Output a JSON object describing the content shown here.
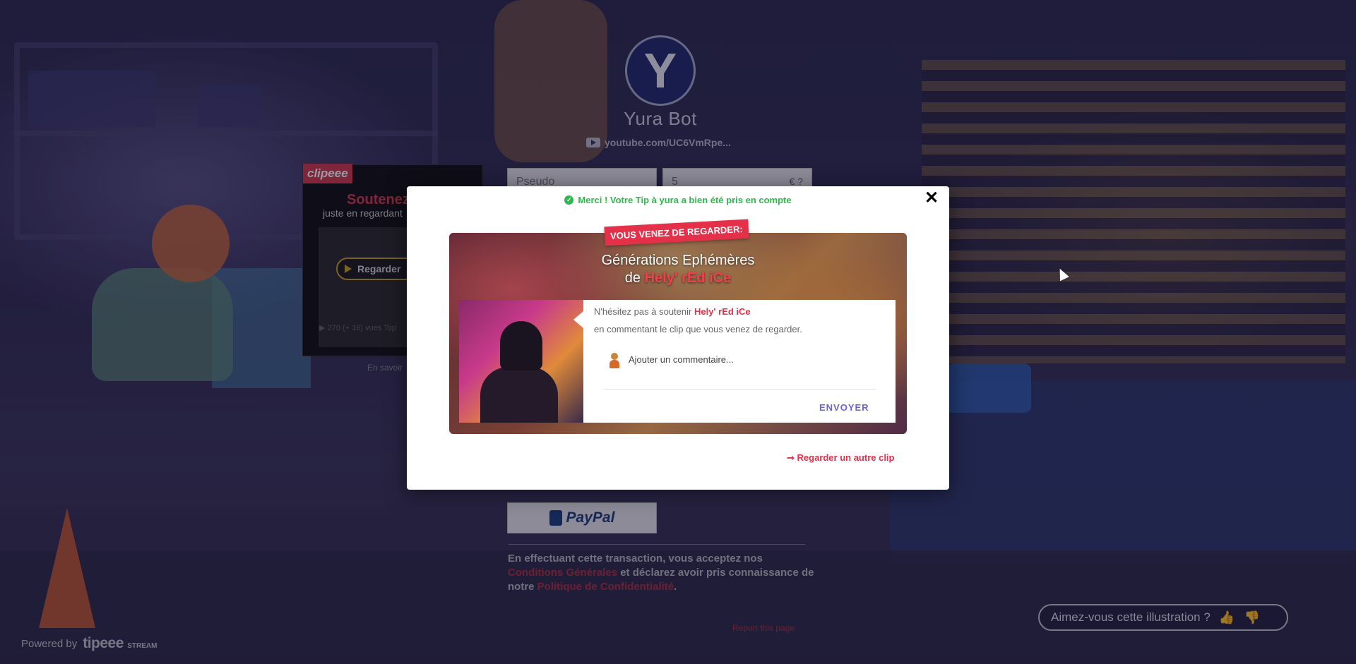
{
  "app": {
    "brand": "Yura Bot",
    "youtube_link": "youtube.com/UC6VmRpe..."
  },
  "form": {
    "pseudo_placeholder": "Pseudo",
    "amount_value": "5",
    "currency_symbol": "€ ?",
    "paypal_label": "PayPal"
  },
  "clipeee_widget": {
    "logo": "clipeee",
    "title": "Soutenez",
    "subtitle": "juste en regardant",
    "watch_button": "Regarder",
    "stats": "▶ 270 (+ 16)   vues   Top",
    "learn_more": "En savoir"
  },
  "terms": {
    "prefix": "En effectuant cette transaction, vous acceptez nos",
    "conditions": "Conditions Générales",
    "middle": "et déclarez avoir pris connaissance de notre",
    "privacy": "Politique de Confidentialité",
    "suffix": "."
  },
  "footer": {
    "powered_by": "Powered by",
    "tipeee_logo": "tipeee",
    "tipeee_stream": "STREAM",
    "report": "Report this page"
  },
  "illustration_feedback": {
    "question": "Aimez-vous cette illustration ?",
    "like_icon": "thumbs-up-icon",
    "dislike_icon": "thumbs-down-icon"
  },
  "modal": {
    "success_message": "Merci ! Votre Tip à yura a bien été pris en compte",
    "ribbon": "VOUS VENEZ DE REGARDER:",
    "clip_title": "Générations Ephémères",
    "by_prefix": "de",
    "artist": "Hely' rEd iCe",
    "support_prefix": "N'hésitez pas à soutenir",
    "support_line2": "en commentant le clip que vous venez de regarder.",
    "comment_placeholder": "Ajouter un commentaire...",
    "send_button": "ENVOYER",
    "another_clip": "➞ Regarder un autre clip",
    "close_icon": "close-icon"
  },
  "colors": {
    "accent_red": "#e5304a",
    "success_green": "#2fb84b",
    "send_purple": "#6b63d8",
    "bg_navy": "#2a2547"
  }
}
